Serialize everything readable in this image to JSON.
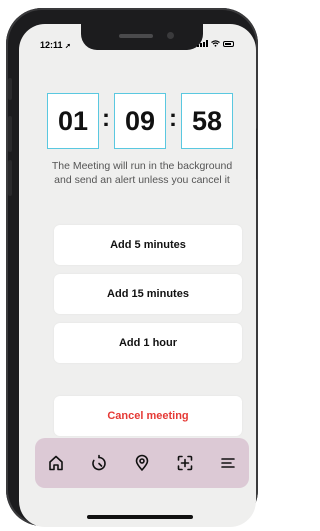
{
  "status_bar": {
    "time": "12:11",
    "location_arrow": "location-arrow-icon"
  },
  "timer": {
    "hours": "01",
    "minutes": "09",
    "seconds": "58",
    "separator": ":",
    "border_color": "#5ac8e0"
  },
  "message": "The Meeting will run in the background and send an alert unless you cancel it",
  "actions": {
    "add_5": "Add 5 minutes",
    "add_15": "Add 15 minutes",
    "add_hour": "Add 1 hour",
    "cancel": "Cancel meeting",
    "cancel_color": "#e53935"
  },
  "tabbar": {
    "background": "#dcc9d5",
    "items": [
      {
        "icon": "home-icon"
      },
      {
        "icon": "timer-icon"
      },
      {
        "icon": "location-pin-icon"
      },
      {
        "icon": "scan-icon"
      },
      {
        "icon": "menu-icon"
      }
    ]
  }
}
